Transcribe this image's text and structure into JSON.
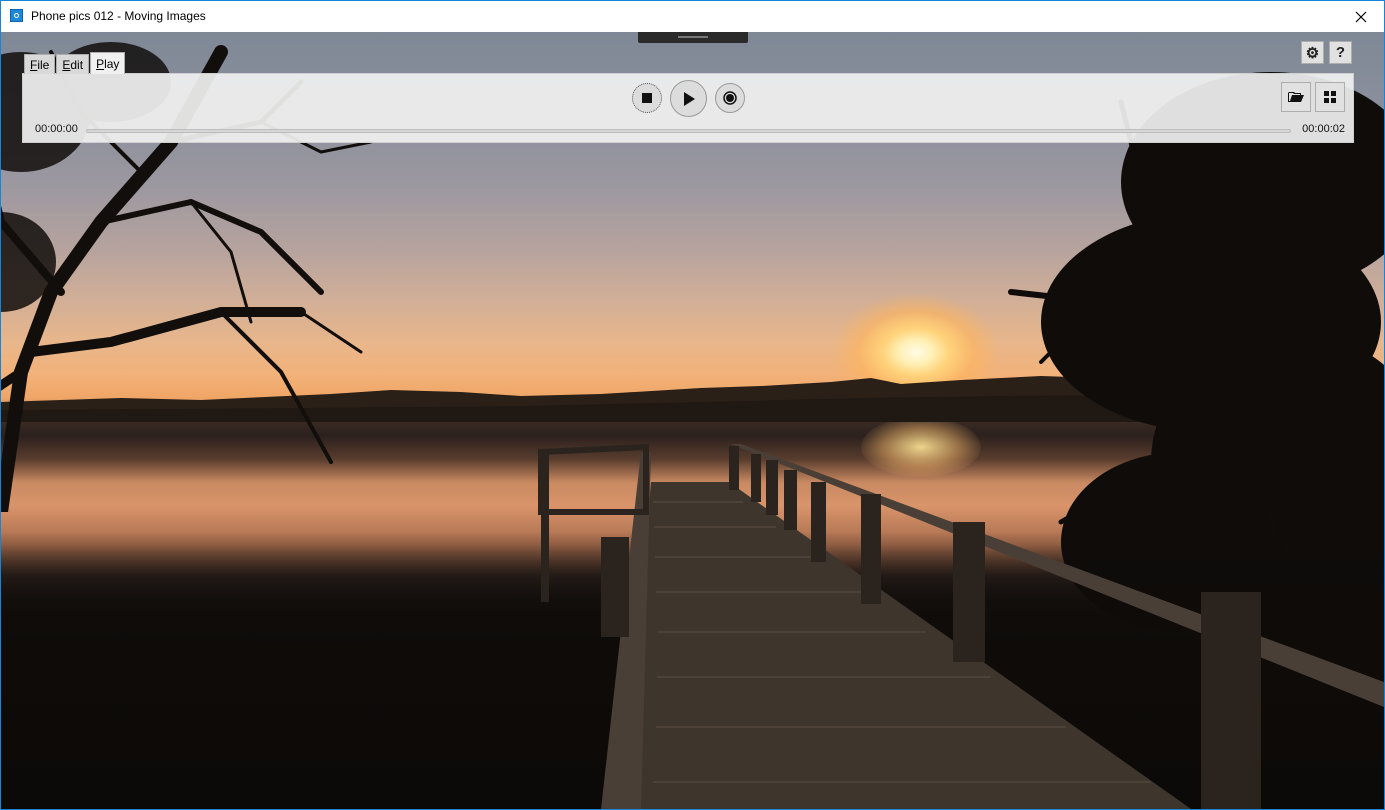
{
  "window": {
    "title": "Phone pics 012 - Moving Images",
    "app_icon": "moving-images-app-icon",
    "close_icon": "close-icon"
  },
  "menu": {
    "tabs": [
      {
        "label": "File",
        "accel": "F",
        "rest": "ile",
        "active": false
      },
      {
        "label": "Edit",
        "accel": "E",
        "rest": "dit",
        "active": false
      },
      {
        "label": "Play",
        "accel": "P",
        "rest": "lay",
        "active": true
      }
    ]
  },
  "corner_buttons": {
    "settings": {
      "icon": "gear-icon",
      "glyph": "⚙"
    },
    "help": {
      "icon": "help-icon",
      "glyph": "?"
    }
  },
  "transport": {
    "stop_icon": "stop-icon",
    "play_icon": "play-icon",
    "record_icon": "record-icon",
    "open_icon": "folder-open-icon",
    "layout_icon": "grid-icon"
  },
  "playback": {
    "current_time": "00:00:00",
    "total_time": "00:00:02",
    "progress": 0
  },
  "colors": {
    "accent": "#1883d7",
    "toolbar_bg": "#f0f0f0"
  }
}
